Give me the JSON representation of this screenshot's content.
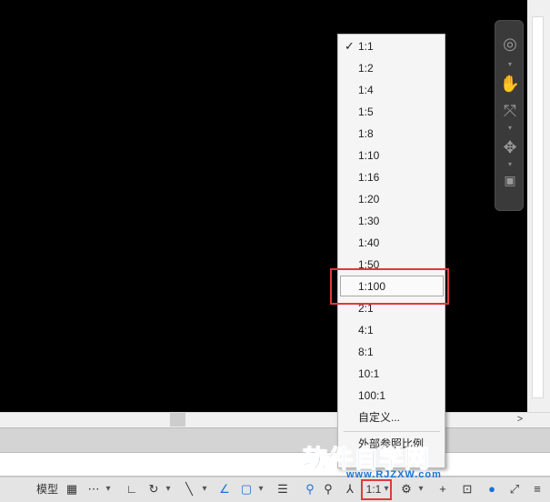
{
  "statusbar": {
    "model_label": "模型",
    "scale_value": "1:1"
  },
  "scale_menu": {
    "checked": "1:1",
    "items": [
      "1:1",
      "1:2",
      "1:4",
      "1:5",
      "1:8",
      "1:10",
      "1:16",
      "1:20",
      "1:30",
      "1:40",
      "1:50",
      "1:100",
      "2:1",
      "4:1",
      "8:1",
      "10:1",
      "100:1",
      "自定义..."
    ],
    "highlighted": "1:100",
    "external_ref": "外部参照比例"
  },
  "watermark": {
    "main": "软件自学网",
    "sub": "www.RJZXW.com"
  },
  "icons": {
    "check": "✓",
    "dropdown": "▾",
    "scroll_right": ">"
  }
}
